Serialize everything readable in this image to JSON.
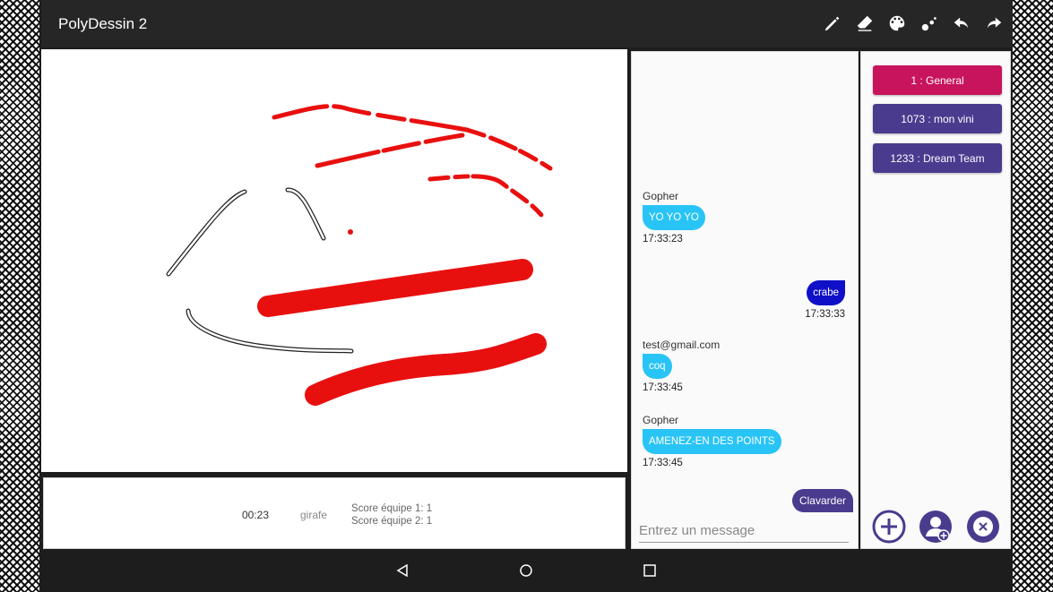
{
  "appbar": {
    "title": "PolyDessin 2",
    "tools": [
      "pencil-icon",
      "eraser-icon",
      "palette-icon",
      "stroke-size-icon",
      "undo-icon",
      "redo-icon"
    ]
  },
  "game": {
    "timer": "00:23",
    "word": "girafe",
    "score1": "Score équipe 1: 1",
    "score2": "Score équipe 2: 1"
  },
  "chat": {
    "messages": [
      {
        "author": "Gopher",
        "text": "YO YO YO",
        "time": "17:33:23",
        "side": "in"
      },
      {
        "author": "",
        "text": "crabe",
        "time": "17:33:33",
        "side": "out"
      },
      {
        "author": "test@gmail.com",
        "text": "coq",
        "time": "17:33:45",
        "side": "in"
      },
      {
        "author": "Gopher",
        "text": "AMENEZ-EN DES POINTS",
        "time": "17:33:45",
        "side": "in"
      }
    ],
    "send_label": "Clavarder",
    "input_placeholder": "Entrez un message"
  },
  "channels": {
    "items": [
      {
        "label": "1 : General",
        "color": "#c8145c"
      },
      {
        "label": "1073 : mon vini",
        "color": "#4a3b8e"
      },
      {
        "label": "1233 : Dream Team",
        "color": "#4a3b8e"
      }
    ],
    "buttons": [
      "add-channel-icon",
      "join-channel-icon",
      "leave-channel-icon"
    ]
  },
  "colors": {
    "stroke_red": "#e8100f",
    "accent_purple": "#4a3b8e",
    "bubble_in": "#29c4f6",
    "bubble_out": "#1010c8"
  }
}
